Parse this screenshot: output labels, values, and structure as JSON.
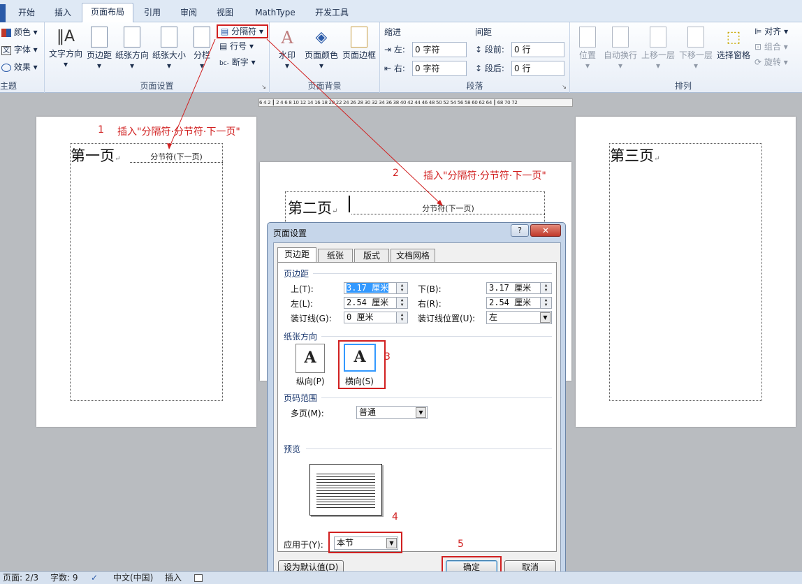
{
  "tabs": [
    "开始",
    "插入",
    "页面布局",
    "引用",
    "审阅",
    "视图",
    "MathType",
    "开发工具"
  ],
  "ribbon": {
    "theme": {
      "colors": "颜色",
      "fonts": "字体",
      "effects": "效果",
      "group": "主题"
    },
    "page_setup": {
      "text_dir": "文字方向",
      "margins": "页边距",
      "orientation": "纸张方向",
      "size": "纸张大小",
      "columns": "分栏",
      "breaks": "分隔符",
      "line_numbers": "行号",
      "hyphenation": "断字",
      "group": "页面设置"
    },
    "page_bg": {
      "watermark": "水印",
      "page_color": "页面颜色",
      "page_border": "页面边框",
      "group": "页面背景"
    },
    "paragraph": {
      "indent": "缩进",
      "spacing": "间距",
      "left_label": "左:",
      "right_label": "右:",
      "before_label": "段前:",
      "after_label": "段后:",
      "left_val": "0 字符",
      "right_val": "0 字符",
      "before_val": "0 行",
      "after_val": "0 行",
      "group": "段落"
    },
    "arrange": {
      "position": "位置",
      "wrap": "自动换行",
      "bring_forward": "上移一层",
      "send_backward": "下移一层",
      "selection_pane": "选择窗格",
      "align": "对齐",
      "group_btn": "组合",
      "rotate": "旋转",
      "group": "排列"
    }
  },
  "ruler": "6 4 2 ┃ 2 4 6 8 10 12 14 16 18 20 22 24 26 28 30 32 34 36 38 40 42 44 46 48 50 52 54 56 58 60 62 64 ┃ 68 70 72",
  "pages": {
    "p1": "第一页",
    "p2": "第二页",
    "p3": "第三页",
    "break_label": "分节符(下一页)",
    "return_mark": "↵"
  },
  "annotations": {
    "n1": "1",
    "t1": "插入\"分隔符·分节符·下一页\"",
    "n2": "2",
    "t2": "插入\"分隔符·分节符·下一页\"",
    "n3": "3",
    "n4": "4",
    "n5": "5"
  },
  "dialog": {
    "title": "页面设置",
    "help": "?",
    "tabs": [
      "页边距",
      "纸张",
      "版式",
      "文档网格"
    ],
    "margins_section": "页边距",
    "top_label": "上(T):",
    "top_val": "3.17 厘米",
    "bottom_label": "下(B):",
    "bottom_val": "3.17 厘米",
    "left_label": "左(L):",
    "left_val": "2.54 厘米",
    "right_label": "右(R):",
    "right_val": "2.54 厘米",
    "gutter_label": "装订线(G):",
    "gutter_val": "0 厘米",
    "gutter_pos_label": "装订线位置(U):",
    "gutter_pos_val": "左",
    "orientation_section": "纸张方向",
    "portrait": "纵向(P)",
    "landscape": "横向(S)",
    "glyph": "A",
    "pages_section": "页码范围",
    "multi_label": "多页(M):",
    "multi_val": "普通",
    "preview_section": "预览",
    "apply_label": "应用于(Y):",
    "apply_val": "本节",
    "default_btn": "设为默认值(D)",
    "ok_btn": "确定",
    "cancel_btn": "取消"
  },
  "status": {
    "page": "页面: 2/3",
    "words": "字数: 9",
    "lang": "中文(中国)",
    "mode": "插入"
  },
  "colors": {
    "annotation": "#d12020",
    "accent": "#3399ff"
  }
}
